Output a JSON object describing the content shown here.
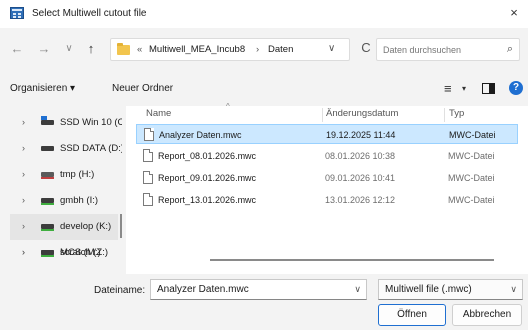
{
  "window": {
    "title": "Select Multiwell cutout file",
    "close_glyph": "×",
    "icon": "dialog-window-icon"
  },
  "nav": {
    "back": "←",
    "forward": "→",
    "history": "∨",
    "up": "↑",
    "breadcrumb_more": "«",
    "breadcrumb": [
      "Multiwell_MEA_Incub8",
      "Daten"
    ],
    "breadcrumb_sep": "›",
    "address_dropdown": "∨",
    "refresh": "C",
    "search_placeholder": "Daten durchsuchen",
    "search_glyph": "⌕"
  },
  "toolbar": {
    "organize": "Organisieren ▾",
    "new_folder": "Neuer Ordner",
    "view_glyph": "≡",
    "view_dropdown": "▾",
    "help_glyph": "?"
  },
  "sidebar": {
    "items": [
      {
        "label": "SSD Win 10 (C",
        "icon": "windows-drive-icon",
        "selected": false
      },
      {
        "label": "SSD DATA (D:)",
        "icon": "drive-icon",
        "selected": false
      },
      {
        "label": "tmp (H:)",
        "icon": "network-drive-icon",
        "selected": false
      },
      {
        "label": "gmbh (I:)",
        "icon": "drive-icon",
        "selected": false
      },
      {
        "label": "develop (K:)",
        "icon": "drive-icon",
        "selected": true
      },
      {
        "label": "MCS (M:)",
        "icon": "drive-icon",
        "selected": false
      },
      {
        "label": "scratch (Z:)",
        "icon": "drive-icon",
        "selected": false
      }
    ],
    "expander_glyph": "›"
  },
  "files": {
    "columns": {
      "name": "Name",
      "date": "Änderungsdatum",
      "type": "Typ"
    },
    "sort_glyph": "^",
    "rows": [
      {
        "name": "Analyzer Daten.mwc",
        "date": "19.12.2025 11:44",
        "type": "MWC-Datei",
        "selected": true
      },
      {
        "name": "Report_08.01.2026.mwc",
        "date": "08.01.2026 10:38",
        "type": "MWC-Datei",
        "selected": false
      },
      {
        "name": "Report_09.01.2026.mwc",
        "date": "09.01.2026 10:41",
        "type": "MWC-Datei",
        "selected": false
      },
      {
        "name": "Report_13.01.2026.mwc",
        "date": "13.01.2026 12:12",
        "type": "MWC-Datei",
        "selected": false
      }
    ]
  },
  "footer": {
    "filename_label": "Dateiname:",
    "filename_value": "Analyzer Daten.mwc",
    "filter_value": "Multiwell file (.mwc)",
    "dropdown_glyph": "∨",
    "open_label": "Öffnen",
    "cancel_label": "Abbrechen"
  },
  "colors": {
    "accent": "#1f6fd1",
    "selection": "#cce8ff",
    "selection_border": "#99d1ff"
  }
}
